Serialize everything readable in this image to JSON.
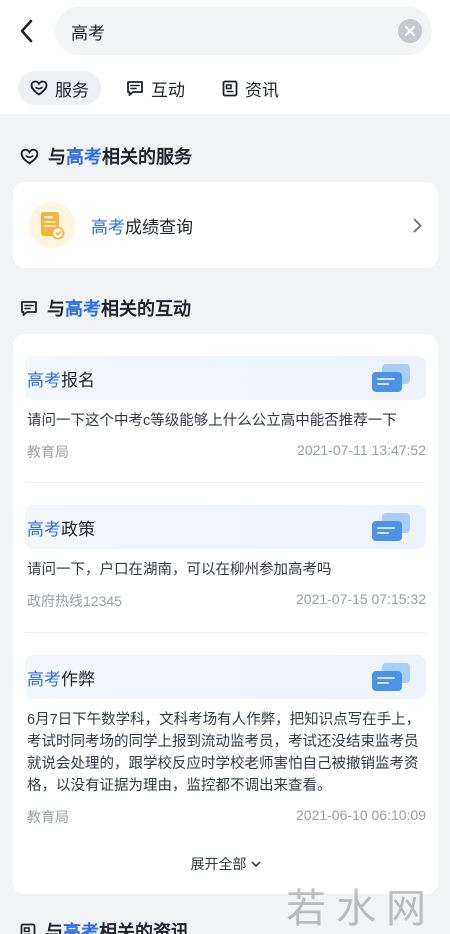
{
  "search": {
    "query": "高考"
  },
  "tabs": [
    {
      "label": "服务",
      "icon": "heart-icon",
      "active": true
    },
    {
      "label": "互动",
      "icon": "message-icon",
      "active": false
    },
    {
      "label": "资讯",
      "icon": "news-icon",
      "active": false
    }
  ],
  "services": {
    "title_prefix": "与",
    "title_keyword": "高考",
    "title_suffix": "相关的服务",
    "item": {
      "keyword": "高考",
      "label_rest": "成绩查询",
      "icon": "document-icon"
    }
  },
  "interactions": {
    "title_prefix": "与",
    "title_keyword": "高考",
    "title_suffix": "相关的互动",
    "items": [
      {
        "keyword": "高考",
        "title_rest": "报名",
        "body": "请问一下这个中考c等级能够上什么公立高中能否推荐一下",
        "source": "教育局",
        "time": "2021-07-11 13:47:52"
      },
      {
        "keyword": "高考",
        "title_rest": "政策",
        "body": "请问一下，户口在湖南，可以在柳州参加高考吗",
        "source": "政府热线12345",
        "time": "2021-07-15 07:15:32"
      },
      {
        "keyword": "高考",
        "title_rest": "作弊",
        "body": "6月7日下午数学科，文科考场有人作弊，把知识点写在手上，考试时同考场的同学上报到流动监考员，考试还没结束监考员就说会处理的，跟学校反应时学校老师害怕自己被撤销监考资格，以没有证据为理由，监控都不调出来查看。",
        "source": "教育局",
        "time": "2021-06-10 06:10:09"
      }
    ],
    "expand_label": "展开全部"
  },
  "news": {
    "title_prefix": "与",
    "title_keyword": "高考",
    "title_suffix": "相关的资讯"
  },
  "watermark": "若水网",
  "colors": {
    "accent": "#2f6fe0",
    "background": "#f2f3f5",
    "card": "#ffffff",
    "muted": "#9aa0a8"
  }
}
